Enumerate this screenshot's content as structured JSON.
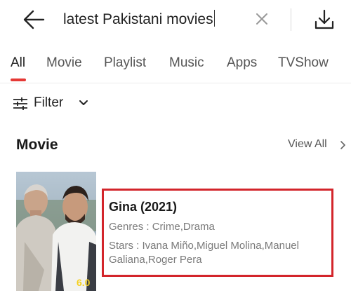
{
  "search": {
    "query": "latest Pakistani movies"
  },
  "tabs": [
    {
      "label": "All"
    },
    {
      "label": "Movie"
    },
    {
      "label": "Playlist"
    },
    {
      "label": "Music"
    },
    {
      "label": "Apps"
    },
    {
      "label": "TVShow"
    }
  ],
  "filter": {
    "label": "Filter"
  },
  "section": {
    "title": "Movie",
    "view_all_label": "View All"
  },
  "movie": {
    "title": "Gina (2021)",
    "genres": "Genres : Crime,Drama",
    "stars": "Stars : Ivana Miño,Miguel Molina,Manuel Galiana,Roger Pera",
    "rating": "6.0"
  },
  "colors": {
    "accent": "#e53935",
    "highlight_border": "#d3252b",
    "rating": "#f5d020"
  }
}
